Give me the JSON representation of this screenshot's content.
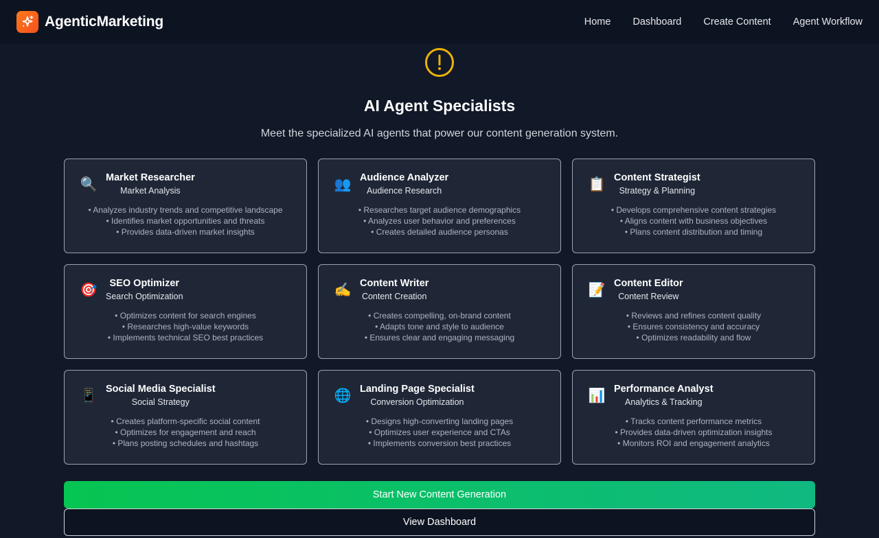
{
  "header": {
    "brand": "AgenticMarketing",
    "logo_icon": "sparkles-icon",
    "nav": [
      {
        "label": "Home"
      },
      {
        "label": "Dashboard"
      },
      {
        "label": "Create Content"
      },
      {
        "label": "Agent Workflow"
      }
    ]
  },
  "main": {
    "alert_icon": "exclamation-circle-icon",
    "alert_color": "#eab308",
    "title": "AI Agent Specialists",
    "subtitle": "Meet the specialized AI agents that power our content generation system.",
    "agents": [
      {
        "icon": "🔍",
        "icon_name": "magnifier-icon",
        "title": "Market Researcher",
        "role": "Market Analysis",
        "points": [
          "Analyzes industry trends and competitive landscape",
          "Identifies market opportunities and threats",
          "Provides data-driven market insights"
        ]
      },
      {
        "icon": "👥",
        "icon_name": "people-icon",
        "title": "Audience Analyzer",
        "role": "Audience Research",
        "points": [
          "Researches target audience demographics",
          "Analyzes user behavior and preferences",
          "Creates detailed audience personas"
        ]
      },
      {
        "icon": "📋",
        "icon_name": "clipboard-icon",
        "title": "Content Strategist",
        "role": "Strategy & Planning",
        "points": [
          "Develops comprehensive content strategies",
          "Aligns content with business objectives",
          "Plans content distribution and timing"
        ]
      },
      {
        "icon": "🎯",
        "icon_name": "target-icon",
        "title": "SEO Optimizer",
        "role": "Search Optimization",
        "points": [
          "Optimizes content for search engines",
          "Researches high-value keywords",
          "Implements technical SEO best practices"
        ]
      },
      {
        "icon": "✍️",
        "icon_name": "writing-hand-icon",
        "title": "Content Writer",
        "role": "Content Creation",
        "points": [
          "Creates compelling, on-brand content",
          "Adapts tone and style to audience",
          "Ensures clear and engaging messaging"
        ]
      },
      {
        "icon": "📝",
        "icon_name": "memo-icon",
        "title": "Content Editor",
        "role": "Content Review",
        "points": [
          "Reviews and refines content quality",
          "Ensures consistency and accuracy",
          "Optimizes readability and flow"
        ]
      },
      {
        "icon": "📱",
        "icon_name": "mobile-phone-icon",
        "title": "Social Media Specialist",
        "role": "Social Strategy",
        "points": [
          "Creates platform-specific social content",
          "Optimizes for engagement and reach",
          "Plans posting schedules and hashtags"
        ]
      },
      {
        "icon": "🌐",
        "icon_name": "globe-icon",
        "title": "Landing Page Specialist",
        "role": "Conversion Optimization",
        "points": [
          "Designs high-converting landing pages",
          "Optimizes user experience and CTAs",
          "Implements conversion best practices"
        ]
      },
      {
        "icon": "📊",
        "icon_name": "bar-chart-icon",
        "title": "Performance Analyst",
        "role": "Analytics & Tracking",
        "points": [
          "Tracks content performance metrics",
          "Provides data-driven optimization insights",
          "Monitors ROI and engagement analytics"
        ]
      }
    ]
  },
  "actions": {
    "primary_label": "Start New Content Generation",
    "secondary_label": "View Dashboard"
  },
  "colors": {
    "background": "#111827",
    "navbar": "#0d1421",
    "card": "#1f2737",
    "accent_orange": "#f4511e",
    "accent_green": "#06c552"
  }
}
